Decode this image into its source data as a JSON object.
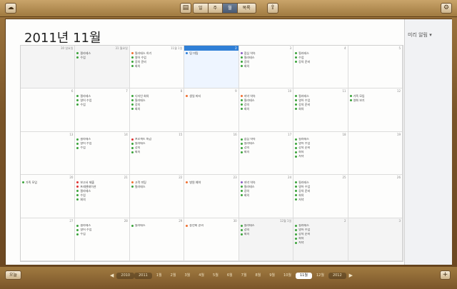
{
  "toolbar": {
    "calendar_icon": "cloud-icon",
    "calendars_icon": "calendar-list-icon",
    "views": [
      {
        "label": "일",
        "active": false
      },
      {
        "label": "주",
        "active": false
      },
      {
        "label": "월",
        "active": true
      },
      {
        "label": "목록",
        "active": false
      }
    ],
    "share_icon": "share-icon",
    "settings_icon": "gear-icon"
  },
  "month_title": "2011년 11월",
  "reminders": {
    "label": "미리 알림 ▾"
  },
  "calendar": {
    "weeks": [
      {
        "days": [
          {
            "num": "30 일요일",
            "other": true,
            "events": [],
            "band": null
          },
          {
            "num": "31 월요일",
            "other": true,
            "events": [
              {
                "title": "필라테스",
                "color": "#3aa33a"
              },
              {
                "title": "수업",
                "color": "#3aa33a"
              }
            ]
          },
          {
            "num": "11월 1일",
            "events": [
              {
                "title": "필라테스 하기",
                "color": "#f07030"
              },
              {
                "title": "영어 수업",
                "color": "#3aa33a"
              },
              {
                "title": "강의 준비",
                "color": "#3aa33a"
              },
              {
                "title": "회의",
                "color": "#3aa33a"
              }
            ]
          },
          {
            "num": "2",
            "today": true,
            "today_label": "오늘",
            "events": [
              {
                "title": "팀 미팅",
                "color": "#2f7fd6"
              }
            ]
          },
          {
            "num": "3",
            "events": [
              {
                "title": "점심 약속",
                "color": "#8a5cc2"
              },
              {
                "title": "필라테스",
                "color": "#3aa33a"
              },
              {
                "title": "강의",
                "color": "#3aa33a"
              },
              {
                "title": "회의",
                "color": "#3aa33a"
              }
            ]
          },
          {
            "num": "4",
            "events": [
              {
                "title": "필라테스",
                "color": "#3aa33a"
              },
              {
                "title": "수업",
                "color": "#3aa33a"
              },
              {
                "title": "강의 준비",
                "color": "#3aa33a"
              }
            ]
          },
          {
            "num": "5",
            "events": []
          }
        ]
      },
      {
        "days": [
          {
            "num": "6",
            "events": []
          },
          {
            "num": "7",
            "events": [
              {
                "title": "필라테스",
                "color": "#3aa33a"
              },
              {
                "title": "영어 수업",
                "color": "#3aa33a"
              },
              {
                "title": "수업",
                "color": "#3aa33a"
              }
            ]
          },
          {
            "num": "8",
            "events": [
              {
                "title": "디자인 회의",
                "color": "#3aa33a"
              },
              {
                "title": "필라테스",
                "color": "#3aa33a"
              },
              {
                "title": "강의",
                "color": "#3aa33a"
              },
              {
                "title": "회의",
                "color": "#3aa33a"
              }
            ]
          },
          {
            "num": "9",
            "events": [
              {
                "title": "생일 파티",
                "color": "#f07030"
              }
            ]
          },
          {
            "num": "10",
            "events": [
              {
                "title": "저녁 약속",
                "color": "#f07030"
              },
              {
                "title": "필라테스",
                "color": "#3aa33a"
              },
              {
                "title": "강의",
                "color": "#3aa33a"
              },
              {
                "title": "회의",
                "color": "#3aa33a"
              }
            ]
          },
          {
            "num": "11",
            "events": [
              {
                "title": "필라테스",
                "color": "#3aa33a"
              },
              {
                "title": "영어 수업",
                "color": "#3aa33a"
              },
              {
                "title": "강의 준비",
                "color": "#3aa33a"
              },
              {
                "title": "회의",
                "color": "#3aa33a"
              }
            ]
          },
          {
            "num": "12",
            "events": [
              {
                "title": "가족 모임",
                "color": "#3aa33a"
              },
              {
                "title": "영화 보기",
                "color": "#3aa33a"
              }
            ]
          }
        ]
      },
      {
        "days": [
          {
            "num": "13",
            "events": []
          },
          {
            "num": "14",
            "events": [
              {
                "title": "필라테스",
                "color": "#3aa33a"
              },
              {
                "title": "영어 수업",
                "color": "#3aa33a"
              },
              {
                "title": "수업",
                "color": "#3aa33a"
              }
            ]
          },
          {
            "num": "15",
            "events": [
              {
                "title": "프로젝트 마감",
                "color": "#e03030"
              },
              {
                "title": "필라테스",
                "color": "#3aa33a"
              },
              {
                "title": "강의",
                "color": "#3aa33a"
              },
              {
                "title": "회의",
                "color": "#3aa33a"
              }
            ]
          },
          {
            "num": "16",
            "events": []
          },
          {
            "num": "17",
            "events": [
              {
                "title": "점심 약속",
                "color": "#3aa33a"
              },
              {
                "title": "필라테스",
                "color": "#3aa33a"
              },
              {
                "title": "강의",
                "color": "#3aa33a"
              },
              {
                "title": "회의",
                "color": "#3aa33a"
              }
            ]
          },
          {
            "num": "18",
            "events": [
              {
                "title": "필라테스",
                "color": "#3aa33a"
              },
              {
                "title": "영어 수업",
                "color": "#3aa33a"
              },
              {
                "title": "강의 준비",
                "color": "#3aa33a"
              },
              {
                "title": "회의",
                "color": "#3aa33a"
              },
              {
                "title": "저녁",
                "color": "#3aa33a"
              }
            ]
          },
          {
            "num": "19",
            "events": []
          }
        ]
      },
      {
        "days": [
          {
            "num": "20",
            "events": [
              {
                "title": "가족 모임",
                "color": "#3aa33a"
              }
            ]
          },
          {
            "num": "21",
            "events": [
              {
                "title": "보고서 제출",
                "color": "#e03030"
              },
              {
                "title": "프레젠테이션",
                "color": "#e03030"
              },
              {
                "title": "필라테스",
                "color": "#3aa33a"
              },
              {
                "title": "수업",
                "color": "#3aa33a"
              },
              {
                "title": "회의",
                "color": "#3aa33a"
              }
            ]
          },
          {
            "num": "22",
            "events": [
              {
                "title": "고객 미팅",
                "color": "#f07030"
              },
              {
                "title": "필라테스",
                "color": "#3aa33a"
              }
            ]
          },
          {
            "num": "23",
            "events": [
              {
                "title": "병원 예약",
                "color": "#f07030"
              }
            ]
          },
          {
            "num": "24",
            "events": [
              {
                "title": "저녁 약속",
                "color": "#8a5cc2"
              },
              {
                "title": "필라테스",
                "color": "#3aa33a"
              },
              {
                "title": "강의",
                "color": "#3aa33a"
              },
              {
                "title": "회의",
                "color": "#3aa33a"
              }
            ]
          },
          {
            "num": "25",
            "events": [
              {
                "title": "필라테스",
                "color": "#3aa33a"
              },
              {
                "title": "영어 수업",
                "color": "#3aa33a"
              },
              {
                "title": "강의 준비",
                "color": "#3aa33a"
              },
              {
                "title": "회의",
                "color": "#3aa33a"
              },
              {
                "title": "저녁",
                "color": "#3aa33a"
              }
            ]
          },
          {
            "num": "26",
            "events": []
          }
        ]
      },
      {
        "days": [
          {
            "num": "27",
            "events": []
          },
          {
            "num": "28",
            "events": [
              {
                "title": "필라테스",
                "color": "#3aa33a"
              },
              {
                "title": "영어 수업",
                "color": "#3aa33a"
              },
              {
                "title": "수업",
                "color": "#3aa33a"
              }
            ]
          },
          {
            "num": "29",
            "events": [
              {
                "title": "필라테스",
                "color": "#3aa33a"
              }
            ]
          },
          {
            "num": "30",
            "events": [
              {
                "title": "송년회 준비",
                "color": "#f07030"
              }
            ]
          },
          {
            "num": "12월 1일",
            "other": true,
            "events": [
              {
                "title": "필라테스",
                "color": "#3aa33a"
              },
              {
                "title": "강의",
                "color": "#3aa33a"
              },
              {
                "title": "회의",
                "color": "#3aa33a"
              }
            ]
          },
          {
            "num": "2",
            "other": true,
            "events": [
              {
                "title": "필라테스",
                "color": "#3aa33a"
              },
              {
                "title": "영어 수업",
                "color": "#3aa33a"
              },
              {
                "title": "강의 준비",
                "color": "#3aa33a"
              },
              {
                "title": "회의",
                "color": "#3aa33a"
              },
              {
                "title": "저녁",
                "color": "#3aa33a"
              }
            ]
          },
          {
            "num": "3",
            "other": true,
            "events": []
          }
        ]
      }
    ]
  },
  "bottombar": {
    "today_label": "오늘",
    "add_label": "+",
    "prev_label": "◀",
    "next_label": "▶",
    "months": [
      {
        "label": "2010",
        "yr": true
      },
      {
        "label": "2011",
        "yr": true
      },
      {
        "label": "1월"
      },
      {
        "label": "2월"
      },
      {
        "label": "3월"
      },
      {
        "label": "4월"
      },
      {
        "label": "5월"
      },
      {
        "label": "6월"
      },
      {
        "label": "7월"
      },
      {
        "label": "8월"
      },
      {
        "label": "9월"
      },
      {
        "label": "10월"
      },
      {
        "label": "11월",
        "active": true
      },
      {
        "label": "12월"
      },
      {
        "label": "2012",
        "yr": true
      }
    ]
  }
}
